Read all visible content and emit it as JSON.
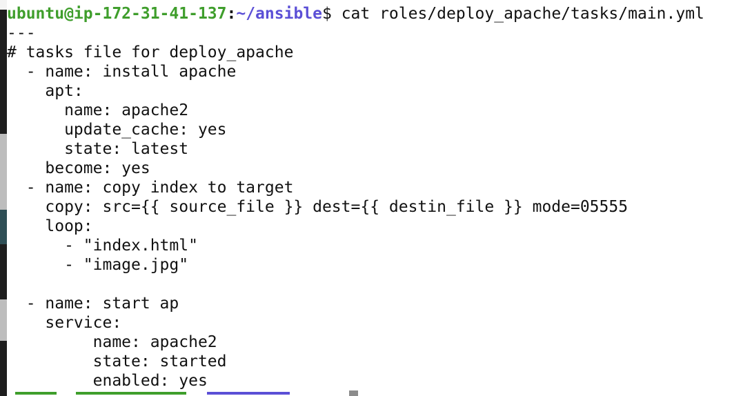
{
  "terminal": {
    "prompt": {
      "user_host": "ubuntu@ip-172-31-41-137",
      "separator": ":",
      "path": "~/ansible",
      "symbol": "$",
      "command": " cat roles/deploy_apache/tasks/main.yml"
    },
    "output_lines": [
      "---",
      "# tasks file for deploy_apache",
      "  - name: install apache",
      "    apt:",
      "      name: apache2",
      "      update_cache: yes",
      "      state: latest",
      "    become: yes",
      "  - name: copy index to target",
      "    copy: src={{ source_file }} dest={{ destin_file }} mode=05555",
      "    loop:",
      "      - \"index.html\"",
      "      - \"image.jpg\"",
      "",
      "  - name: start ap",
      "    service:",
      "         name: apache2",
      "         state: started",
      "         enabled: yes"
    ]
  },
  "colors": {
    "background": "#ffffff",
    "text": "#111111",
    "prompt_user": "#3f9e2c",
    "prompt_path": "#5b4fd6",
    "cursor": "#8c8c8c"
  }
}
